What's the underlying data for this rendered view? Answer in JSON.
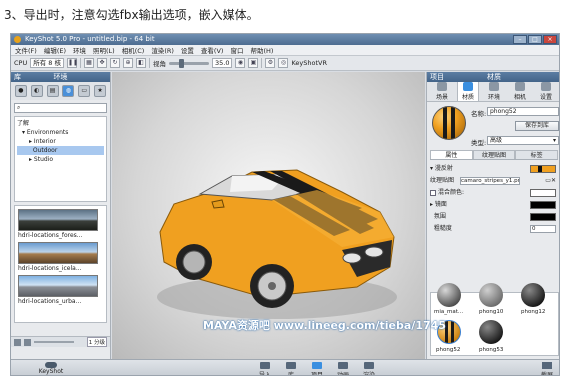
{
  "caption": "3、导出时，注意勾选fbx输出选项，嵌入媒体。",
  "window": {
    "title": "KeyShot 5.0 Pro - untitled.bip - 64 bit",
    "buttons": [
      "–",
      "□",
      "×"
    ]
  },
  "menu": [
    "文件(F)",
    "编辑(E)",
    "环境",
    "照明(L)",
    "相机(C)",
    "渲染(R)",
    "设置",
    "查看(V)",
    "窗口",
    "帮助(H)"
  ],
  "toolbar": {
    "cpu_label": "CPU",
    "cores_value": "所有 8 核",
    "fov_label": "视角",
    "fov_value": "35.0",
    "keyshotvr_label": "KeyShotVR"
  },
  "library": {
    "header": "库",
    "title": "环境",
    "tree": [
      "了解",
      "Environments",
      "Interior",
      "Outdoor",
      "Studio"
    ],
    "thumbnails": [
      {
        "label": "hdri-locations_fores..."
      },
      {
        "label": "hdri-locations_icela..."
      },
      {
        "label": "hdri-locations_urba..."
      }
    ],
    "view_badge": "1 分级"
  },
  "project": {
    "header": "项目",
    "title": "材质",
    "tabs": [
      "场景",
      "材质",
      "环境",
      "相机",
      "设置"
    ],
    "name_label": "名称:",
    "name_value": "phong52",
    "save_button": "保存到库",
    "type_label": "类型:",
    "type_value": "高级",
    "subtabs": [
      "属性",
      "纹理贴图",
      "标签"
    ],
    "properties": {
      "diffuse_label": "漫反射",
      "texture_label": "纹理贴图",
      "texture_value": "camaro_stripes_y1.png",
      "mix_label": "混合颜色:",
      "specular_label": "镜面",
      "ambient_label": "氛围",
      "roughness_label": "粗糙度",
      "roughness_value": "0"
    },
    "materials": [
      "mia_mat...",
      "phong10",
      "phong12",
      "phong52",
      "phong53"
    ]
  },
  "bottombar": {
    "cloud_label": "KeyShot Cloud",
    "nav": [
      "导入",
      "库",
      "项目",
      "动画",
      "渲染"
    ],
    "fullscreen_label": "截屏"
  },
  "watermark": "MAYA资源吧 www.lineeg.com/tieba/1745",
  "colors": {
    "car_body": "#f0a020",
    "stripe": "#1a1a1a",
    "accent": "#3a8fe0",
    "panel_header": "#4d6c90"
  }
}
